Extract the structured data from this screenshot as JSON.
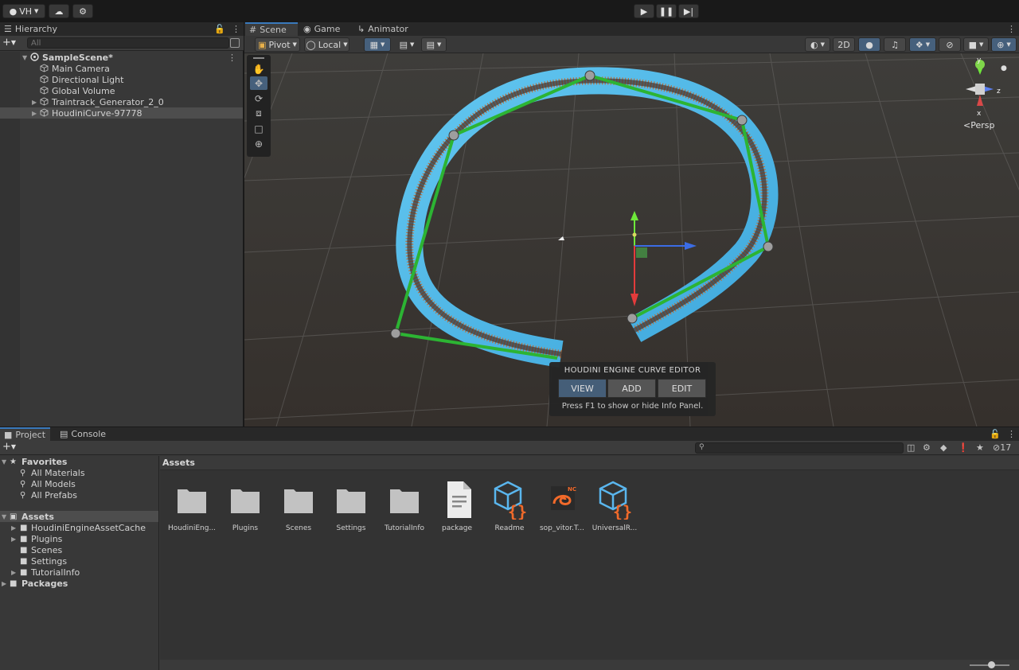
{
  "toolbar": {
    "account_label": "VH",
    "play_icon": "play-icon",
    "pause_icon": "pause-icon",
    "step_icon": "step-icon"
  },
  "hierarchy": {
    "tab_label": "Hierarchy",
    "search_placeholder": "All",
    "items": [
      {
        "label": "SampleScene*",
        "depth": 0
      },
      {
        "label": "Main Camera",
        "depth": 1
      },
      {
        "label": "Directional Light",
        "depth": 1
      },
      {
        "label": "Global Volume",
        "depth": 1
      },
      {
        "label": "Traintrack_Generator_2_0",
        "depth": 1
      },
      {
        "label": "HoudiniCurve-97778",
        "depth": 1
      }
    ]
  },
  "scene": {
    "tabs": [
      "Scene",
      "Game",
      "Animator"
    ],
    "pivot_label": "Pivot",
    "local_label": "Local",
    "mode_2d_label": "2D",
    "persp_label": "Persp",
    "gizmo_axes": {
      "y": "y",
      "x": "x",
      "z": "z"
    },
    "curve_editor": {
      "title": "HOUDINI ENGINE CURVE EDITOR",
      "buttons": [
        "VIEW",
        "ADD",
        "EDIT"
      ],
      "active": "VIEW",
      "hint": "Press F1 to show or hide Info Panel."
    }
  },
  "project": {
    "tabs": [
      "Project",
      "Console"
    ],
    "hidden_count": "17",
    "assets_header": "Assets",
    "favorites": {
      "label": "Favorites",
      "items": [
        "All Materials",
        "All Models",
        "All Prefabs"
      ]
    },
    "tree": {
      "assets_label": "Assets",
      "assets_children": [
        "HoudiniEngineAssetCache",
        "Plugins",
        "Scenes",
        "Settings",
        "TutorialInfo"
      ],
      "packages_label": "Packages"
    },
    "assets": [
      {
        "name": "HoudiniEng...",
        "kind": "folder"
      },
      {
        "name": "Plugins",
        "kind": "folder"
      },
      {
        "name": "Scenes",
        "kind": "folder"
      },
      {
        "name": "Settings",
        "kind": "folder"
      },
      {
        "name": "TutorialInfo",
        "kind": "folder"
      },
      {
        "name": "package",
        "kind": "file"
      },
      {
        "name": "Readme",
        "kind": "script-asset"
      },
      {
        "name": "sop_vitor.T...",
        "kind": "houdini-asset"
      },
      {
        "name": "UniversalR...",
        "kind": "script-asset"
      }
    ]
  },
  "colors": {
    "accent": "#46607c",
    "track_blue": "#58c1ec",
    "curve_green": "#2cb433",
    "houdini_orange": "#f26a2a"
  }
}
